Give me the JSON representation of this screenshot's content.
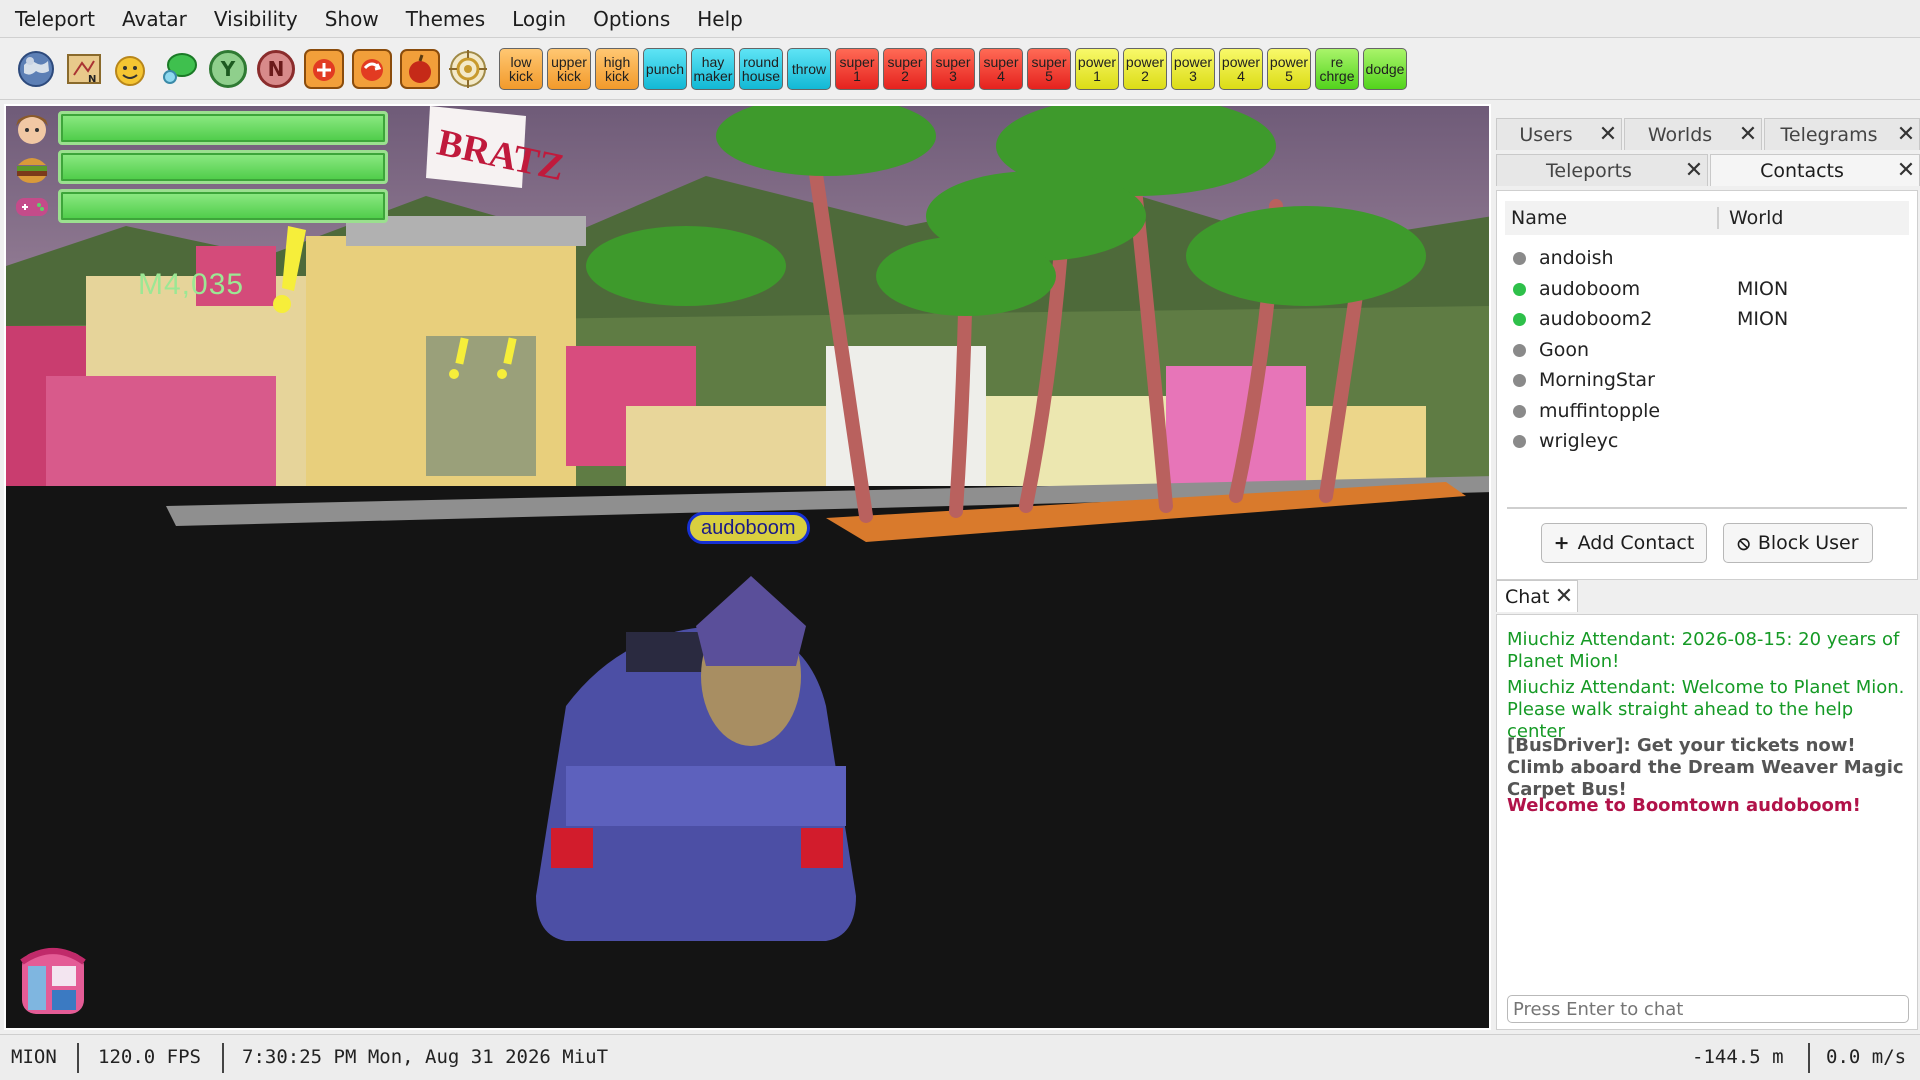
{
  "menu": [
    "Teleport",
    "Avatar",
    "Visibility",
    "Show",
    "Themes",
    "Login",
    "Options",
    "Help"
  ],
  "toolbar": {
    "icons": [
      "globe-icon",
      "map-icon",
      "emote-icon",
      "chat-bubble-icon",
      "yes-icon",
      "no-icon",
      "teleport-plus-icon",
      "teleport-return-icon",
      "apple-icon",
      "target-icon"
    ],
    "yes_label": "Y",
    "no_label": "N",
    "combos": [
      {
        "label": "low\nkick",
        "color": "orange"
      },
      {
        "label": "upper\nkick",
        "color": "orange"
      },
      {
        "label": "high\nkick",
        "color": "orange"
      },
      {
        "label": "punch",
        "color": "cyan"
      },
      {
        "label": "hay\nmaker",
        "color": "cyan"
      },
      {
        "label": "round\nhouse",
        "color": "cyan"
      },
      {
        "label": "throw",
        "color": "cyan"
      },
      {
        "label": "super\n1",
        "color": "red"
      },
      {
        "label": "super\n2",
        "color": "red"
      },
      {
        "label": "super\n3",
        "color": "red"
      },
      {
        "label": "super\n4",
        "color": "red"
      },
      {
        "label": "super\n5",
        "color": "red"
      },
      {
        "label": "power\n1",
        "color": "yellow"
      },
      {
        "label": "power\n2",
        "color": "yellow"
      },
      {
        "label": "power\n3",
        "color": "yellow"
      },
      {
        "label": "power\n4",
        "color": "yellow"
      },
      {
        "label": "power\n5",
        "color": "yellow"
      },
      {
        "label": "re\nchrge",
        "color": "green"
      },
      {
        "label": "dodge",
        "color": "green"
      }
    ]
  },
  "game": {
    "stats": [
      {
        "icon": "face-icon",
        "level": 1.0
      },
      {
        "icon": "food-icon",
        "level": 1.0
      },
      {
        "icon": "gamepad-icon",
        "level": 1.0
      }
    ],
    "ticket_count": "M4,035",
    "player_name": "audoboom",
    "billboard": "BRATZ",
    "shop_icon": "shop-icon"
  },
  "tabs_row1": [
    {
      "label": "Users"
    },
    {
      "label": "Worlds"
    },
    {
      "label": "Telegrams"
    }
  ],
  "tabs_row2": [
    {
      "label": "Teleports"
    },
    {
      "label": "Contacts"
    }
  ],
  "contacts": {
    "col_name": "Name",
    "col_world": "World",
    "rows": [
      {
        "name": "andoish",
        "world": "",
        "online": false
      },
      {
        "name": "audoboom",
        "world": "MION",
        "online": true
      },
      {
        "name": "audoboom2",
        "world": "MION",
        "online": true
      },
      {
        "name": "Goon",
        "world": "",
        "online": false
      },
      {
        "name": "MorningStar",
        "world": "",
        "online": false
      },
      {
        "name": "muffintopple",
        "world": "",
        "online": false
      },
      {
        "name": "wrigleyc",
        "world": "",
        "online": false
      }
    ],
    "add_label": "Add Contact",
    "block_label": "Block User"
  },
  "chat": {
    "tab_label": "Chat",
    "messages": [
      {
        "text": "Miuchiz Attendant:    2026-08-15: 20 years of Planet Mion!",
        "kind": "att"
      },
      {
        "text": "Miuchiz Attendant:    Welcome to Planet Mion.  Please walk straight ahead to the help center",
        "kind": "att"
      },
      {
        "text": "[BusDriver]:    Get your tickets now! Climb aboard the Dream Weaver Magic Carpet Bus!",
        "kind": "bus"
      },
      {
        "text": "Welcome to Boomtown audoboom!",
        "kind": "welcome"
      }
    ],
    "placeholder": "Press Enter to chat"
  },
  "status": {
    "world": "MION",
    "fps": "120.0 FPS",
    "time": "7:30:25 PM Mon, Aug 31 2026 MiuT",
    "altitude": "-144.5 m",
    "speed": "0.0 m/s"
  },
  "colors": {
    "online": "#2ec04a",
    "offline": "#8a8a8a",
    "attendant": "#159a25",
    "welcome": "#b11249",
    "nametag": "#d9cf3f"
  }
}
